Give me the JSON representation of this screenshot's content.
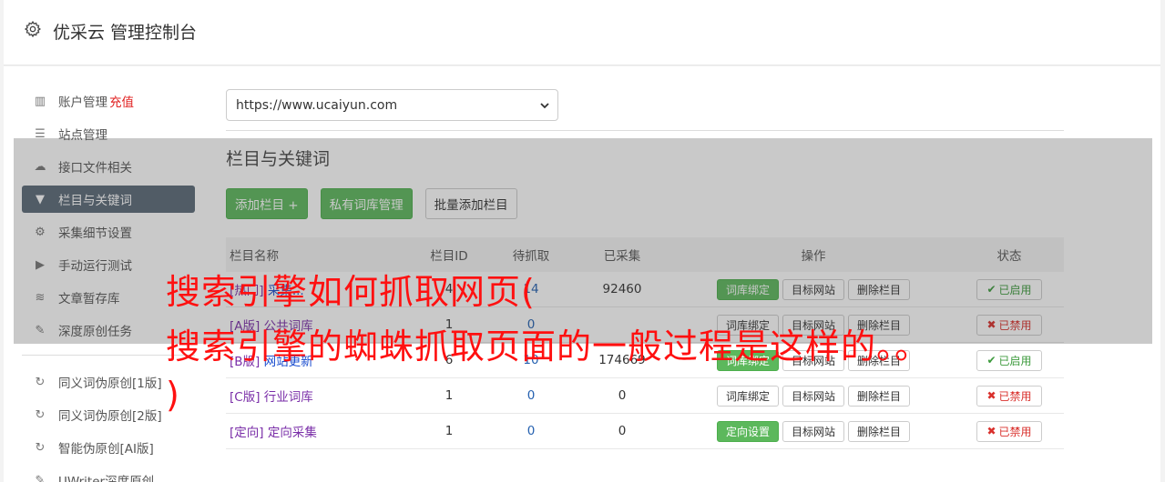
{
  "header": {
    "title": "优采云 管理控制台",
    "icon": "gear-icon"
  },
  "sidebar": {
    "items": [
      {
        "label": "账户管理",
        "extra": "充值",
        "icon": "bar-chart-icon"
      },
      {
        "label": "站点管理",
        "icon": "server-icon"
      },
      {
        "label": "接口文件相关",
        "icon": "cloud-upload-icon"
      },
      {
        "label": "栏目与关键词",
        "icon": "filter-icon",
        "active": true
      },
      {
        "label": "采集细节设置",
        "icon": "cogs-icon"
      },
      {
        "label": "手动运行测试",
        "icon": "play-circle-icon"
      },
      {
        "label": "文章暂存库",
        "icon": "database-icon"
      },
      {
        "label": "深度原创任务",
        "icon": "edit-icon"
      }
    ],
    "items2": [
      {
        "label": "同义词伪原创[1版]",
        "icon": "refresh-icon"
      },
      {
        "label": "同义词伪原创[2版]",
        "icon": "refresh-icon"
      },
      {
        "label": "智能伪原创[AI版]",
        "icon": "refresh-icon"
      },
      {
        "label": "UWriter深度原创",
        "icon": "edit-icon"
      }
    ]
  },
  "main": {
    "site_select": "https://www.ucaiyun.com",
    "section_title": "栏目与关键词",
    "buttons": {
      "add_column": "添加栏目 +",
      "private_lib": "私有词库管理",
      "batch_add": "批量添加栏目"
    },
    "table": {
      "headers": [
        "栏目名称",
        "栏目ID",
        "待抓取",
        "已采集",
        "操作",
        "状态"
      ],
      "rows": [
        {
          "tag": "[热门]",
          "name": "采集...",
          "id": "4",
          "pending": "14",
          "collected": "92460",
          "op1": "词库绑定",
          "op1_green": true,
          "op2": "目标网站",
          "op3": "删除栏目",
          "status": "已启用",
          "on": true
        },
        {
          "tag": "[A版]",
          "name": "公共词库",
          "id": "1",
          "pending": "0",
          "collected": "",
          "op1": "词库绑定",
          "op1_green": false,
          "op2": "目标网站",
          "op3": "删除栏目",
          "status": "已禁用",
          "on": false
        },
        {
          "tag": "[B版]",
          "name": "网站更新",
          "id": "6",
          "pending": "10",
          "collected": "174669",
          "op1": "词库绑定",
          "op1_green": true,
          "op2": "目标网站",
          "op3": "删除栏目",
          "status": "已启用",
          "on": true
        },
        {
          "tag": "[C版]",
          "name": "行业词库",
          "id": "1",
          "pending": "0",
          "collected": "0",
          "op1": "词库绑定",
          "op1_green": false,
          "op2": "目标网站",
          "op3": "删除栏目",
          "status": "已禁用",
          "on": false
        },
        {
          "tag": "[定向]",
          "name": "定向采集",
          "id": "1",
          "pending": "0",
          "collected": "0",
          "op1": "定向设置",
          "op1_green": true,
          "op2": "目标网站",
          "op3": "删除栏目",
          "status": "已禁用",
          "on": false
        }
      ]
    }
  },
  "overlay_text": {
    "line1": "搜索引擎如何抓取网页(",
    "line2": "搜索引擎的蜘蛛抓取页面的一般过程是这样的。。",
    "line3": ")"
  }
}
